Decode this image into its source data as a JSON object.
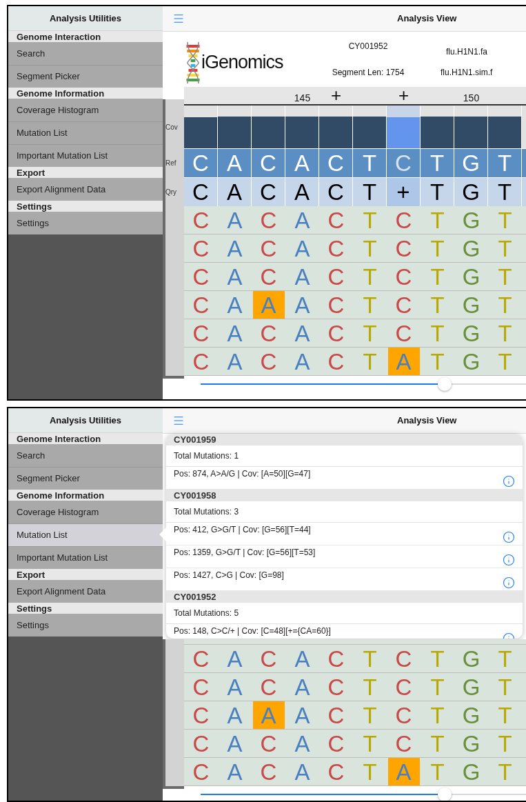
{
  "screens": [
    {
      "sidebar": {
        "title": "Analysis Utilities",
        "sections": [
          {
            "header": "Genome Interaction",
            "items": [
              {
                "label": "Search",
                "selected": false
              },
              {
                "label": "Segment Picker",
                "selected": false
              }
            ]
          },
          {
            "header": "Genome Information",
            "items": [
              {
                "label": "Coverage Histogram",
                "selected": false
              },
              {
                "label": "Mutation List",
                "selected": false
              },
              {
                "label": "Important Mutation List",
                "selected": false
              }
            ]
          },
          {
            "header": "Export",
            "items": [
              {
                "label": "Export Alignment Data",
                "selected": false
              }
            ]
          },
          {
            "header": "Settings",
            "items": [
              {
                "label": "Settings",
                "selected": false
              }
            ]
          }
        ]
      },
      "nav": {
        "title": "Analysis View"
      },
      "header": {
        "logo_text": "iGenomics",
        "segment": "CY001952",
        "segment_length": "Segment Len: 1754",
        "reference_file": "flu.H1N1.fa",
        "reads_file": "flu.H1N1.sim.f"
      },
      "alignment": {
        "row_labels": [
          "Cov",
          "Ref",
          "Qry"
        ],
        "columns": [
          {
            "level": 0.72,
            "selected": false,
            "ref": "C",
            "qry": "C"
          },
          {
            "level": 0.75,
            "selected": false,
            "ref": "A",
            "qry": "A"
          },
          {
            "level": 0.75,
            "selected": false,
            "ref": "C",
            "qry": "C"
          },
          {
            "ruler": "145",
            "level": 0.75,
            "selected": false,
            "ref": "A",
            "qry": "A"
          },
          {
            "ruler": "+",
            "level": 0.75,
            "selected": false,
            "ref": "C",
            "qry": "C"
          },
          {
            "level": 0.75,
            "selected": false,
            "ref": "T",
            "qry": "T"
          },
          {
            "ruler": "+",
            "level": 0.72,
            "selected": true,
            "ref": "C",
            "qry": "+"
          },
          {
            "level": 0.75,
            "selected": false,
            "ref": "T",
            "qry": "T"
          },
          {
            "ruler": "150",
            "level": 0.75,
            "selected": false,
            "ref": "G",
            "qry": "G"
          },
          {
            "level": 0.75,
            "selected": false,
            "ref": "T",
            "qry": "T"
          }
        ],
        "reads": [
          [
            {
              "base": "C",
              "color": "#c94848",
              "mismatch": false
            },
            {
              "base": "A",
              "color": "#4a7fc0",
              "mismatch": false
            },
            {
              "base": "C",
              "color": "#c94848",
              "mismatch": false
            },
            {
              "base": "A",
              "color": "#4a7fc0",
              "mismatch": false
            },
            {
              "base": "C",
              "color": "#c94848",
              "mismatch": false
            },
            {
              "base": "T",
              "color": "#b8a800",
              "mismatch": false
            },
            {
              "base": "C",
              "color": "#c94848",
              "mismatch": false
            },
            {
              "base": "T",
              "color": "#b8a800",
              "mismatch": false
            },
            {
              "base": "G",
              "color": "#6a8f3a",
              "mismatch": false
            },
            {
              "base": "T",
              "color": "#b8a800",
              "mismatch": false
            }
          ],
          [
            {
              "base": "C",
              "color": "#c94848",
              "mismatch": false
            },
            {
              "base": "A",
              "color": "#4a7fc0",
              "mismatch": false
            },
            {
              "base": "C",
              "color": "#c94848",
              "mismatch": false
            },
            {
              "base": "A",
              "color": "#4a7fc0",
              "mismatch": false
            },
            {
              "base": "C",
              "color": "#c94848",
              "mismatch": false
            },
            {
              "base": "T",
              "color": "#b8a800",
              "mismatch": false
            },
            {
              "base": "C",
              "color": "#c94848",
              "mismatch": false
            },
            {
              "base": "T",
              "color": "#b8a800",
              "mismatch": false
            },
            {
              "base": "G",
              "color": "#6a8f3a",
              "mismatch": false
            },
            {
              "base": "T",
              "color": "#b8a800",
              "mismatch": false
            }
          ],
          [
            {
              "base": "C",
              "color": "#c94848",
              "mismatch": false
            },
            {
              "base": "A",
              "color": "#4a7fc0",
              "mismatch": false
            },
            {
              "base": "C",
              "color": "#c94848",
              "mismatch": false
            },
            {
              "base": "A",
              "color": "#4a7fc0",
              "mismatch": false
            },
            {
              "base": "C",
              "color": "#c94848",
              "mismatch": false
            },
            {
              "base": "T",
              "color": "#b8a800",
              "mismatch": false
            },
            {
              "base": "C",
              "color": "#c94848",
              "mismatch": false
            },
            {
              "base": "T",
              "color": "#b8a800",
              "mismatch": false
            },
            {
              "base": "G",
              "color": "#6a8f3a",
              "mismatch": false
            },
            {
              "base": "T",
              "color": "#b8a800",
              "mismatch": false
            }
          ],
          [
            {
              "base": "C",
              "color": "#c94848",
              "mismatch": false
            },
            {
              "base": "A",
              "color": "#4a7fc0",
              "mismatch": false
            },
            {
              "base": "A",
              "color": "#4a7fc0",
              "mismatch": true
            },
            {
              "base": "A",
              "color": "#4a7fc0",
              "mismatch": false
            },
            {
              "base": "C",
              "color": "#c94848",
              "mismatch": false
            },
            {
              "base": "T",
              "color": "#b8a800",
              "mismatch": false
            },
            {
              "base": "C",
              "color": "#c94848",
              "mismatch": false
            },
            {
              "base": "T",
              "color": "#b8a800",
              "mismatch": false
            },
            {
              "base": "G",
              "color": "#6a8f3a",
              "mismatch": false
            },
            {
              "base": "T",
              "color": "#b8a800",
              "mismatch": false
            }
          ],
          [
            {
              "base": "C",
              "color": "#c94848",
              "mismatch": false
            },
            {
              "base": "A",
              "color": "#4a7fc0",
              "mismatch": false
            },
            {
              "base": "C",
              "color": "#c94848",
              "mismatch": false
            },
            {
              "base": "A",
              "color": "#4a7fc0",
              "mismatch": false
            },
            {
              "base": "C",
              "color": "#c94848",
              "mismatch": false
            },
            {
              "base": "T",
              "color": "#b8a800",
              "mismatch": false
            },
            {
              "base": "C",
              "color": "#c94848",
              "mismatch": false
            },
            {
              "base": "T",
              "color": "#b8a800",
              "mismatch": false
            },
            {
              "base": "G",
              "color": "#6a8f3a",
              "mismatch": false
            },
            {
              "base": "T",
              "color": "#b8a800",
              "mismatch": false
            }
          ],
          [
            {
              "base": "C",
              "color": "#c94848",
              "mismatch": false
            },
            {
              "base": "A",
              "color": "#4a7fc0",
              "mismatch": false
            },
            {
              "base": "C",
              "color": "#c94848",
              "mismatch": false
            },
            {
              "base": "A",
              "color": "#4a7fc0",
              "mismatch": false
            },
            {
              "base": "C",
              "color": "#c94848",
              "mismatch": false
            },
            {
              "base": "T",
              "color": "#b8a800",
              "mismatch": false
            },
            {
              "base": "A",
              "color": "#4a7fc0",
              "mismatch": true
            },
            {
              "base": "T",
              "color": "#b8a800",
              "mismatch": false
            },
            {
              "base": "G",
              "color": "#6a8f3a",
              "mismatch": false
            },
            {
              "base": "T",
              "color": "#b8a800",
              "mismatch": false
            }
          ]
        ]
      },
      "slider": {
        "level": 0.75
      }
    },
    {
      "sidebar": {
        "title": "Analysis Utilities",
        "sections": [
          {
            "header": "Genome Interaction",
            "items": [
              {
                "label": "Search",
                "selected": false
              },
              {
                "label": "Segment Picker",
                "selected": false
              }
            ]
          },
          {
            "header": "Genome Information",
            "items": [
              {
                "label": "Coverage Histogram",
                "selected": false
              },
              {
                "label": "Mutation List",
                "selected": true
              },
              {
                "label": "Important Mutation List",
                "selected": false
              }
            ]
          },
          {
            "header": "Export",
            "items": [
              {
                "label": "Export Alignment Data",
                "selected": false
              }
            ]
          },
          {
            "header": "Settings",
            "items": [
              {
                "label": "Settings",
                "selected": false
              }
            ]
          }
        ]
      },
      "nav": {
        "title": "Analysis View"
      },
      "popover": {
        "groups": [
          {
            "title": "CY001959",
            "total": "Total Mutations: 1",
            "mutations": [
              "Pos: 874, A>A/G | Cov: [A=50][G=47]"
            ]
          },
          {
            "title": "CY001958",
            "total": "Total Mutations: 3",
            "mutations": [
              "Pos: 412, G>G/T | Cov: [G=56][T=44]",
              "Pos: 1359, G>G/T | Cov: [G=56][T=53]",
              "Pos: 1427, C>G | Cov: [G=98]"
            ]
          },
          {
            "title": "CY001952",
            "total": "Total Mutations: 5",
            "mutations": [
              "Pos: 148, C>C/+ | Cov: [C=48][+={CA=60}]"
            ]
          }
        ]
      },
      "alignment": {
        "reads": [
          [
            {
              "base": "C",
              "color": "#c94848",
              "mismatch": false
            },
            {
              "base": "A",
              "color": "#4a7fc0",
              "mismatch": false
            },
            {
              "base": "C",
              "color": "#c94848",
              "mismatch": false
            },
            {
              "base": "A",
              "color": "#4a7fc0",
              "mismatch": false
            },
            {
              "base": "C",
              "color": "#c94848",
              "mismatch": false
            },
            {
              "base": "T",
              "color": "#b8a800",
              "mismatch": false
            },
            {
              "base": "C",
              "color": "#c94848",
              "mismatch": false
            },
            {
              "base": "T",
              "color": "#b8a800",
              "mismatch": false
            },
            {
              "base": "G",
              "color": "#6a8f3a",
              "mismatch": false
            },
            {
              "base": "T",
              "color": "#b8a800",
              "mismatch": false
            }
          ],
          [
            {
              "base": "C",
              "color": "#c94848",
              "mismatch": false
            },
            {
              "base": "A",
              "color": "#4a7fc0",
              "mismatch": false
            },
            {
              "base": "C",
              "color": "#c94848",
              "mismatch": false
            },
            {
              "base": "A",
              "color": "#4a7fc0",
              "mismatch": false
            },
            {
              "base": "C",
              "color": "#c94848",
              "mismatch": false
            },
            {
              "base": "T",
              "color": "#b8a800",
              "mismatch": false
            },
            {
              "base": "C",
              "color": "#c94848",
              "mismatch": false
            },
            {
              "base": "T",
              "color": "#b8a800",
              "mismatch": false
            },
            {
              "base": "G",
              "color": "#6a8f3a",
              "mismatch": false
            },
            {
              "base": "T",
              "color": "#b8a800",
              "mismatch": false
            }
          ],
          [
            {
              "base": "C",
              "color": "#c94848",
              "mismatch": false
            },
            {
              "base": "A",
              "color": "#4a7fc0",
              "mismatch": false
            },
            {
              "base": "A",
              "color": "#4a7fc0",
              "mismatch": true
            },
            {
              "base": "A",
              "color": "#4a7fc0",
              "mismatch": false
            },
            {
              "base": "C",
              "color": "#c94848",
              "mismatch": false
            },
            {
              "base": "T",
              "color": "#b8a800",
              "mismatch": false
            },
            {
              "base": "C",
              "color": "#c94848",
              "mismatch": false
            },
            {
              "base": "T",
              "color": "#b8a800",
              "mismatch": false
            },
            {
              "base": "G",
              "color": "#6a8f3a",
              "mismatch": false
            },
            {
              "base": "T",
              "color": "#b8a800",
              "mismatch": false
            }
          ],
          [
            {
              "base": "C",
              "color": "#c94848",
              "mismatch": false
            },
            {
              "base": "A",
              "color": "#4a7fc0",
              "mismatch": false
            },
            {
              "base": "C",
              "color": "#c94848",
              "mismatch": false
            },
            {
              "base": "A",
              "color": "#4a7fc0",
              "mismatch": false
            },
            {
              "base": "C",
              "color": "#c94848",
              "mismatch": false
            },
            {
              "base": "T",
              "color": "#b8a800",
              "mismatch": false
            },
            {
              "base": "C",
              "color": "#c94848",
              "mismatch": false
            },
            {
              "base": "T",
              "color": "#b8a800",
              "mismatch": false
            },
            {
              "base": "G",
              "color": "#6a8f3a",
              "mismatch": false
            },
            {
              "base": "T",
              "color": "#b8a800",
              "mismatch": false
            }
          ],
          [
            {
              "base": "C",
              "color": "#c94848",
              "mismatch": false
            },
            {
              "base": "A",
              "color": "#4a7fc0",
              "mismatch": false
            },
            {
              "base": "C",
              "color": "#c94848",
              "mismatch": false
            },
            {
              "base": "A",
              "color": "#4a7fc0",
              "mismatch": false
            },
            {
              "base": "C",
              "color": "#c94848",
              "mismatch": false
            },
            {
              "base": "T",
              "color": "#b8a800",
              "mismatch": false
            },
            {
              "base": "A",
              "color": "#4a7fc0",
              "mismatch": true
            },
            {
              "base": "T",
              "color": "#b8a800",
              "mismatch": false
            },
            {
              "base": "G",
              "color": "#6a8f3a",
              "mismatch": false
            },
            {
              "base": "T",
              "color": "#b8a800",
              "mismatch": false
            }
          ]
        ]
      },
      "slider": {
        "level": 0.75
      }
    }
  ]
}
